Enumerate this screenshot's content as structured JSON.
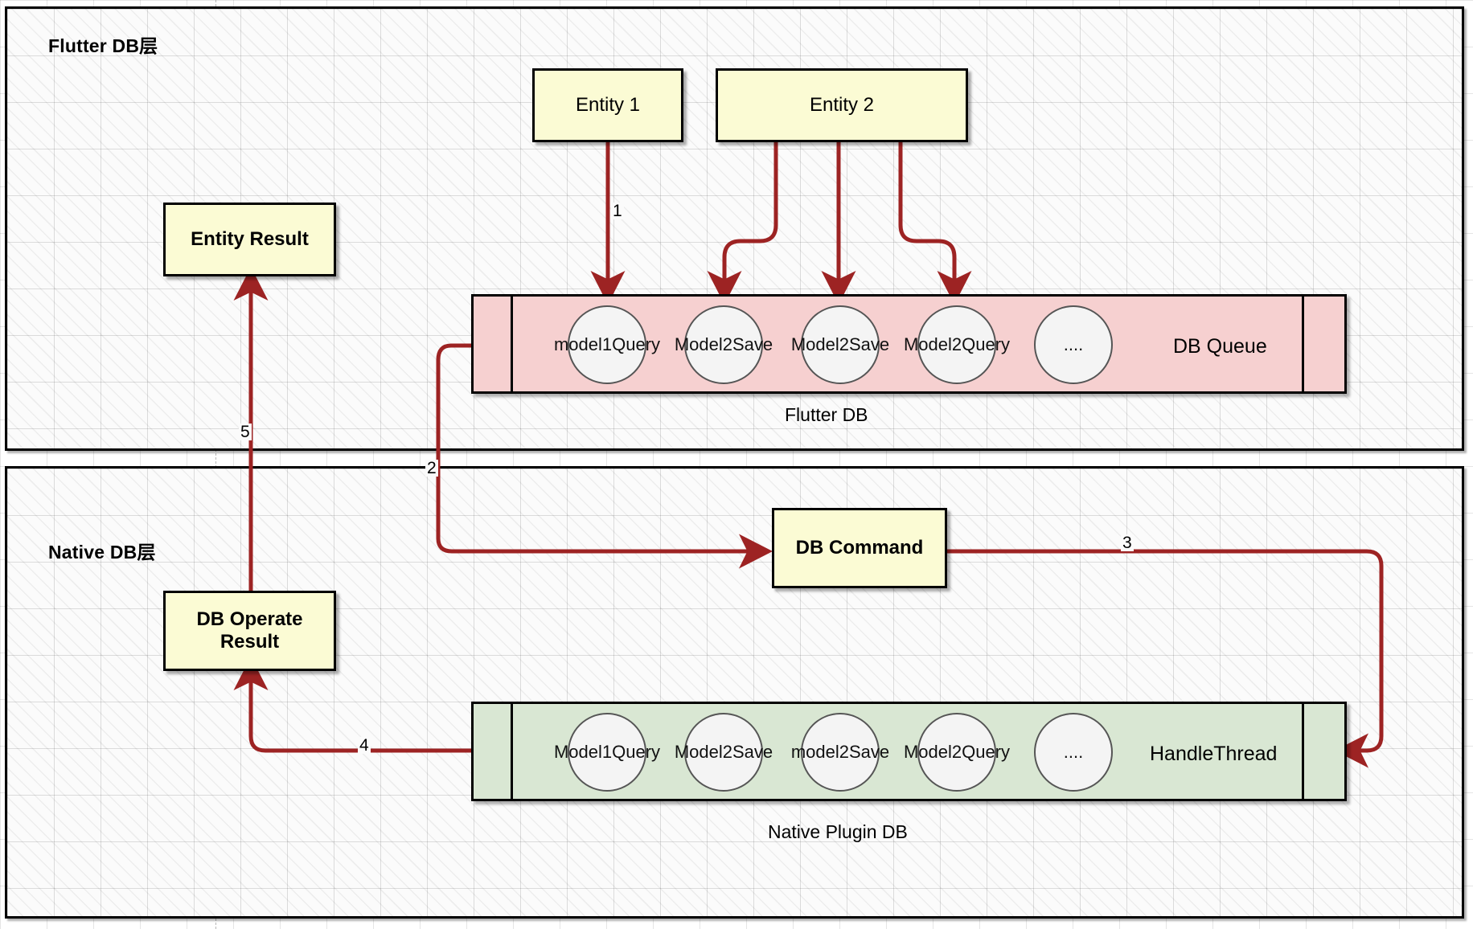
{
  "diagram": {
    "title": "Flutter DB / Native DB layered queue architecture",
    "accent_color": "#9d2323",
    "yellow_box_color": "#fbfbd4",
    "pink_queue_color": "#f6d0d0",
    "green_queue_color": "#d9e7d3"
  },
  "layers": [
    {
      "id": "flutter",
      "title": "Flutter DB层"
    },
    {
      "id": "native",
      "title": "Native DB层"
    }
  ],
  "boxes": {
    "entity1": "Entity 1",
    "entity2": "Entity 2",
    "entity_result": "Entity Result",
    "db_command": "DB Command",
    "db_operate_result": "DB Operate\nResult",
    "db_operate_result_line1": "DB Operate",
    "db_operate_result_line2": "Result"
  },
  "flutter_queue": {
    "label": "DB Queue",
    "caption": "Flutter DB",
    "items": [
      {
        "line1": "model1",
        "line2": "Query"
      },
      {
        "line1": "Model2",
        "line2": "Save"
      },
      {
        "line1": "Model2",
        "line2": "Save"
      },
      {
        "line1": "Model2",
        "line2": "Query"
      },
      {
        "line1": "....",
        "line2": ""
      }
    ]
  },
  "native_queue": {
    "label": "HandleThread",
    "caption": "Native Plugin DB",
    "items": [
      {
        "line1": "Model1",
        "line2": "Query"
      },
      {
        "line1": "Model2",
        "line2": "Save"
      },
      {
        "line1": "model2",
        "line2": "Save"
      },
      {
        "line1": "Model2",
        "line2": "Query"
      },
      {
        "line1": "....",
        "line2": ""
      }
    ]
  },
  "steps": {
    "s1": "1",
    "s2": "2",
    "s3": "3",
    "s4": "4",
    "s5": "5"
  }
}
